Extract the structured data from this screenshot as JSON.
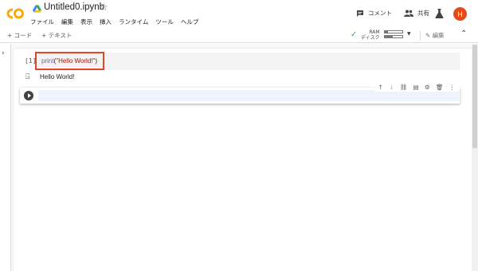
{
  "header": {
    "logo": "CO",
    "title": "Untitled0.ipynb",
    "star_icon": "☆",
    "menu": [
      "ファイル",
      "編集",
      "表示",
      "挿入",
      "ランタイム",
      "ツール",
      "ヘルプ"
    ],
    "comment_label": "コメント",
    "share_label": "共有",
    "avatar_letter": "H"
  },
  "toolbar": {
    "add_code": "+ コード",
    "add_text": "+ テキスト",
    "ram_label": "RAM",
    "disk_label": "ディスク",
    "ram_usage": 0.2,
    "disk_usage": 0.45,
    "edit_label": "編集"
  },
  "cells": [
    {
      "exec_count": "[1]",
      "code_fn": "print",
      "code_open": "(",
      "code_str": "\"Hello World!\"",
      "code_close": ")",
      "output": "Hello World!"
    }
  ],
  "colors": {
    "logo": "#f9ab00",
    "avatar": "#e64a19",
    "highlight": "#e0452a",
    "check": "#34a853"
  }
}
